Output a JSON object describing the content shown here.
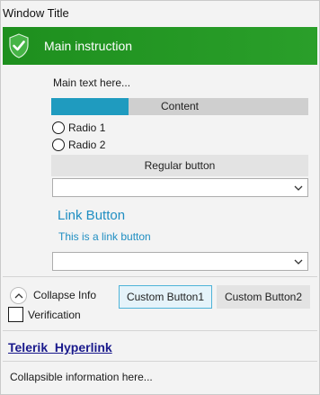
{
  "window": {
    "title": "Window Title"
  },
  "header": {
    "instruction": "Main instruction",
    "icon": "shield-check-icon",
    "color": "#229522"
  },
  "main": {
    "text": "Main text here...",
    "progress": {
      "label": "Content",
      "fraction": 0.3
    },
    "radios": [
      {
        "label": "Radio 1",
        "selected": false
      },
      {
        "label": "Radio 2",
        "selected": false
      }
    ],
    "regular_button": "Regular button",
    "combo1_value": "",
    "link_button": "Link Button",
    "link_text": "This is a link button",
    "combo2_value": ""
  },
  "footer": {
    "collapse_label": "Collapse Info",
    "custom_button_1": "Custom Button1",
    "custom_button_2": "Custom Button2",
    "verification": "Verification",
    "hyperlink": "Telerik_Hyperlink",
    "collapsible_info": "Collapsible information here..."
  },
  "colors": {
    "accent": "#1f9bbf",
    "link": "#1f8ec2",
    "hyperlink": "#1a1a8c"
  }
}
